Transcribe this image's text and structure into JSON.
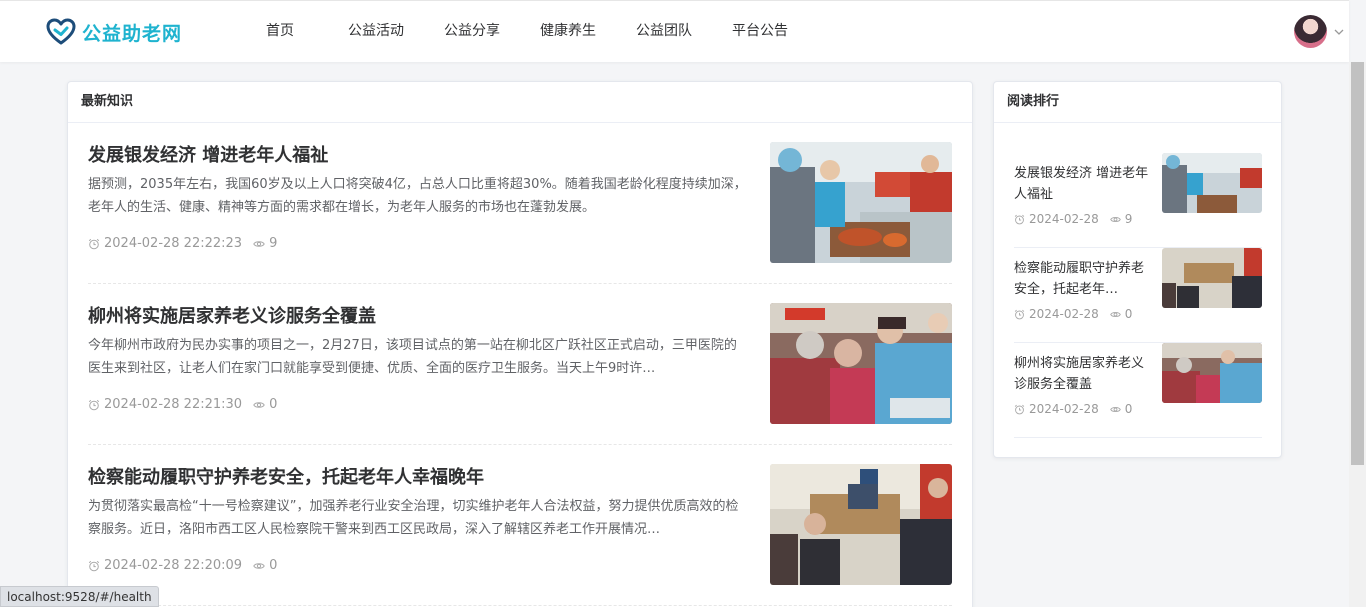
{
  "header": {
    "logo_text": "公益助老网",
    "nav": [
      "首页",
      "公益活动",
      "公益分享",
      "健康养生",
      "公益团队",
      "平台公告"
    ]
  },
  "latest": {
    "title": "最新知识",
    "articles": [
      {
        "title": "发展银发经济 增进老年人福祉",
        "desc": "据预测，2035年左右，我国60岁及以上人口将突破4亿，占总人口比重将超30%。随着我国老龄化程度持续加深，老年人的生活、健康、精神等方面的需求都在增长，为老年人服务的市场也在蓬勃发展。",
        "time": "2024-02-28 22:22:23",
        "views": "9"
      },
      {
        "title": "柳州将实施居家养老义诊服务全覆盖",
        "desc": "今年柳州市政府为民办实事的项目之一，2月27日，该项目试点的第一站在柳北区广跃社区正式启动，三甲医院的医生来到社区，让老人们在家门口就能享受到便捷、优质、全面的医疗卫生服务。当天上午9时许…",
        "time": "2024-02-28 22:21:30",
        "views": "0"
      },
      {
        "title": "检察能动履职守护养老安全，托起老年人幸福晚年",
        "desc": "为贯彻落实最高检“十一号检察建议”，加强养老行业安全治理，切实维护老年人合法权益，努力提供优质高效的检察服务。近日，洛阳市西工区人民检察院干警来到西工区民政局，深入了解辖区养老工作开展情况…",
        "time": "2024-02-28 22:20:09",
        "views": "0"
      }
    ]
  },
  "ranking": {
    "title": "阅读排行",
    "items": [
      {
        "title": "发展银发经济 增进老年人福祉",
        "date": "2024-02-28",
        "views": "9"
      },
      {
        "title": "检察能动履职守护养老安全，托起老年…",
        "date": "2024-02-28",
        "views": "0"
      },
      {
        "title": "柳州将实施居家养老义诊服务全覆盖",
        "date": "2024-02-28",
        "views": "0"
      }
    ]
  },
  "status_url": "localhost:9528/#/health",
  "colors": {
    "brand": "#1fb3cf",
    "logo_icon": "#1d4d7a"
  }
}
